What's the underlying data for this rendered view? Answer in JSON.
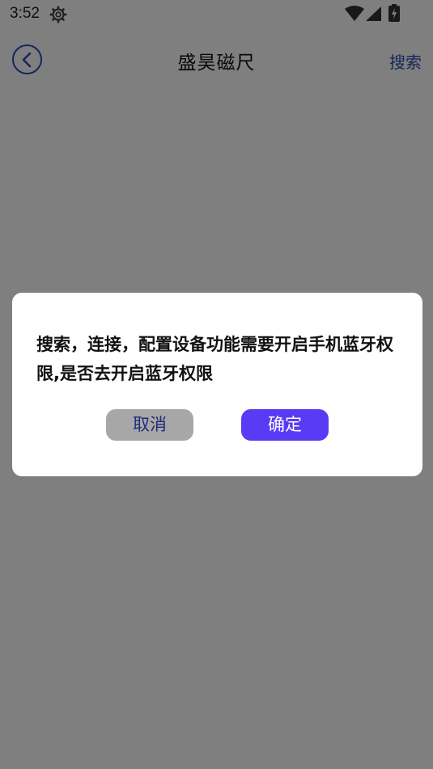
{
  "status_bar": {
    "time": "3:52",
    "icons": [
      "gear-icon",
      "wifi-icon",
      "signal-icon",
      "battery-icon"
    ]
  },
  "app_bar": {
    "back_icon": "chevron-left-icon",
    "title": "盛昊磁尺",
    "search_label": "搜索",
    "accent_color": "#2a4fb3"
  },
  "dialog": {
    "message": "搜索，连接，配置设备功能需要开启手机蓝牙权限,是否去开启蓝牙权限",
    "cancel_label": "取消",
    "confirm_label": "确定",
    "cancel_color": "#a7a7a7",
    "confirm_color": "#5a3bf5"
  }
}
